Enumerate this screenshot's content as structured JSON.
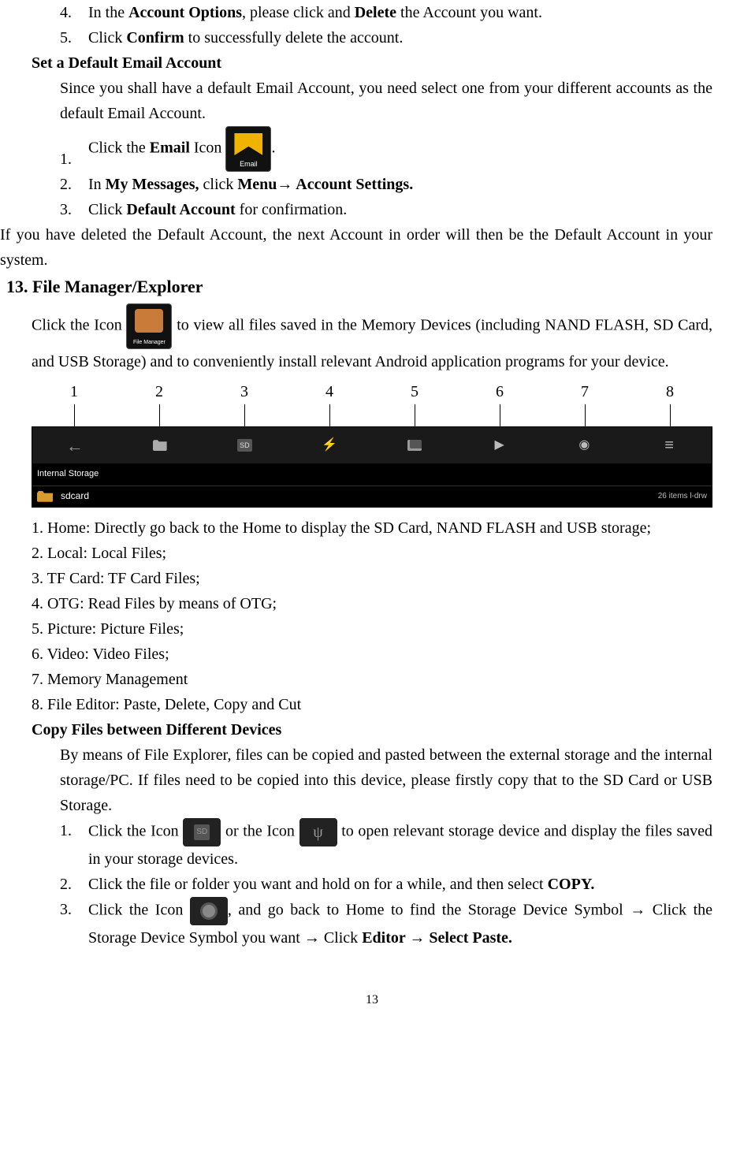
{
  "delete_account": {
    "item4_pre": "In the ",
    "item4_b1": "Account Options",
    "item4_mid": ", please click and ",
    "item4_b2": "Delete",
    "item4_post": " the Account you want.",
    "item5_pre": "Click ",
    "item5_b": "Confirm ",
    "item5_post": "to successfully delete the account."
  },
  "default_email": {
    "heading": "Set a Default Email Account",
    "intro": "Since you shall have a default Email Account, you need select one from your different accounts as the default Email Account.",
    "s1_pre": "Click the ",
    "s1_b": "Email",
    "s1_mid": " Icon ",
    "s1_post": ".",
    "s2_pre": "In ",
    "s2_b1": "My Messages,",
    "s2_mid": " click ",
    "s2_b2": "Menu",
    "s2_arrow": "→",
    "s2_b3": " Account Settings.",
    "s3_pre": "Click ",
    "s3_b": "Default Account",
    "s3_post": " for confirmation.",
    "note": "If you have deleted the Default Account, the next Account in order will then be the Default Account in your system."
  },
  "filemgr": {
    "heading": "13. File Manager/Explorer",
    "intro_pre": "Click the Icon ",
    "intro_post": " to view all files saved in the Memory Devices (including NAND FLASH, SD Card, and USB Storage) and to conveniently install relevant Android application programs for your device.",
    "toolbar_numbers": [
      "1",
      "2",
      "3",
      "4",
      "5",
      "6",
      "7",
      "8"
    ],
    "path_label": "Internal Storage",
    "row_name": "sdcard",
    "row_meta": "26 items l-drw",
    "list": {
      "i1": "1. Home: Directly go back to the Home to display the SD Card, NAND FLASH and USB storage;",
      "i2": "2. Local: Local Files;",
      "i3": "3. TF Card: TF Card Files;",
      "i4": "4. OTG: Read Files by means of OTG;",
      "i5": "5. Picture: Picture Files;",
      "i6": "6. Video: Video Files;",
      "i7": "7. Memory Management",
      "i8": "8. File Editor: Paste, Delete, Copy and Cut"
    }
  },
  "copy": {
    "heading": "Copy Files between Different Devices",
    "intro": "By means of File Explorer, files can be copied and pasted between the external storage and the internal storage/PC. If files need to be copied into this device, please firstly copy that to the SD Card or USB Storage.",
    "s1_pre": "Click the Icon ",
    "s1_mid": " or the Icon ",
    "s1_post": " to open relevant storage device and display the files saved in your storage devices.",
    "s2_pre": "Click the file or folder you want and hold on for a while, and then select ",
    "s2_b": "COPY.",
    "s3_pre": "Click the Icon ",
    "s3_mid": ", and go back to Home to find the Storage Device Symbol ",
    "s3_arrow1": "→",
    "s3_mid2": " Click the Storage Device Symbol you want ",
    "s3_arrow2": "→",
    "s3_mid3": " Click ",
    "s3_b1": "Editor ",
    "s3_arrow3": "→",
    "s3_b2": " Select Paste."
  },
  "nums": {
    "n1": "1.",
    "n2": "2.",
    "n3": "3.",
    "n4": "4.",
    "n5": "5."
  },
  "page_number": "13"
}
